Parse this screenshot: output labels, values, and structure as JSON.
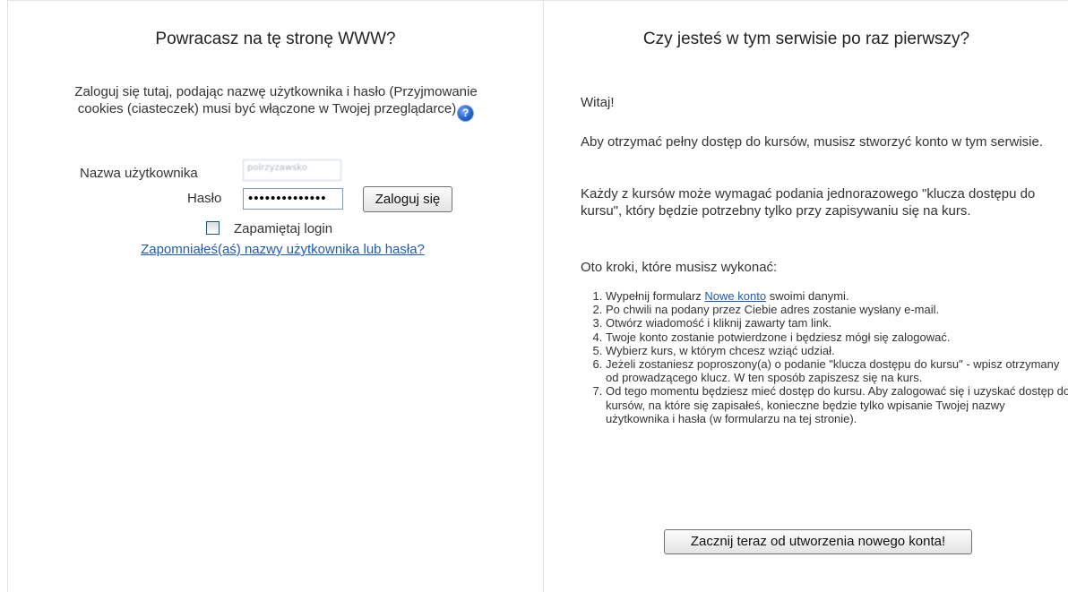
{
  "login": {
    "heading": "Powracasz na tę stronę WWW?",
    "intro": "Zaloguj się tutaj, podając nazwę użytkownika i hasło (Przyjmowanie cookies (ciasteczek) musi być włączone w Twojej przeglądarce)",
    "help_icon": "help-icon",
    "username_label": "Nazwa użytkownika",
    "username_value": "polrzyzawsko",
    "password_label": "Hasło",
    "password_value": "••••••••••••••",
    "login_button": "Zaloguj się",
    "remember_label": "Zapamiętaj login",
    "forgot_link": "Zapomniałeś(aś) nazwy użytkownika lub hasła?"
  },
  "signup": {
    "heading": "Czy jesteś w tym serwisie po raz pierwszy?",
    "greeting": "Witaj!",
    "para1": "Aby otrzymać pełny dostęp do kursów, musisz stworzyć konto w tym serwisie.",
    "para2": "Każdy z kursów może wymagać podania jednorazowego \"klucza dostępu do kursu\", który będzie potrzebny tylko przy zapisywaniu się na kurs.",
    "para3": "Oto kroki, które musisz wykonać:",
    "step1_before": "Wypełnij formularz ",
    "step1_link": "Nowe konto",
    "step1_after": " swoimi danymi.",
    "step2": "Po chwili na podany przez Ciebie adres zostanie wysłany e-mail.",
    "step3": "Otwórz wiadomość i kliknij zawarty tam link.",
    "step4": "Twoje konto zostanie potwierdzone i będziesz mógł się zalogować.",
    "step5": "Wybierz kurs, w którym chcesz wziąć udział.",
    "step6": "Jeżeli zostaniesz poproszony(a) o podanie \"klucza dostępu do kursu\" - wpisz otrzymany od prowadzącego klucz. W ten sposób zapiszesz się na kurs.",
    "step7": "Od tego momentu będziesz mieć dostęp do kursu. Aby zalogować się i uzyskać dostęp do kursów, na które się zapisałeś, konieczne będzie tylko wpisanie Twojej nazwy użytkownika i hasła (w formularzu na tej stronie).",
    "signup_button": "Zacznij teraz od utworzenia nowego konta!"
  }
}
